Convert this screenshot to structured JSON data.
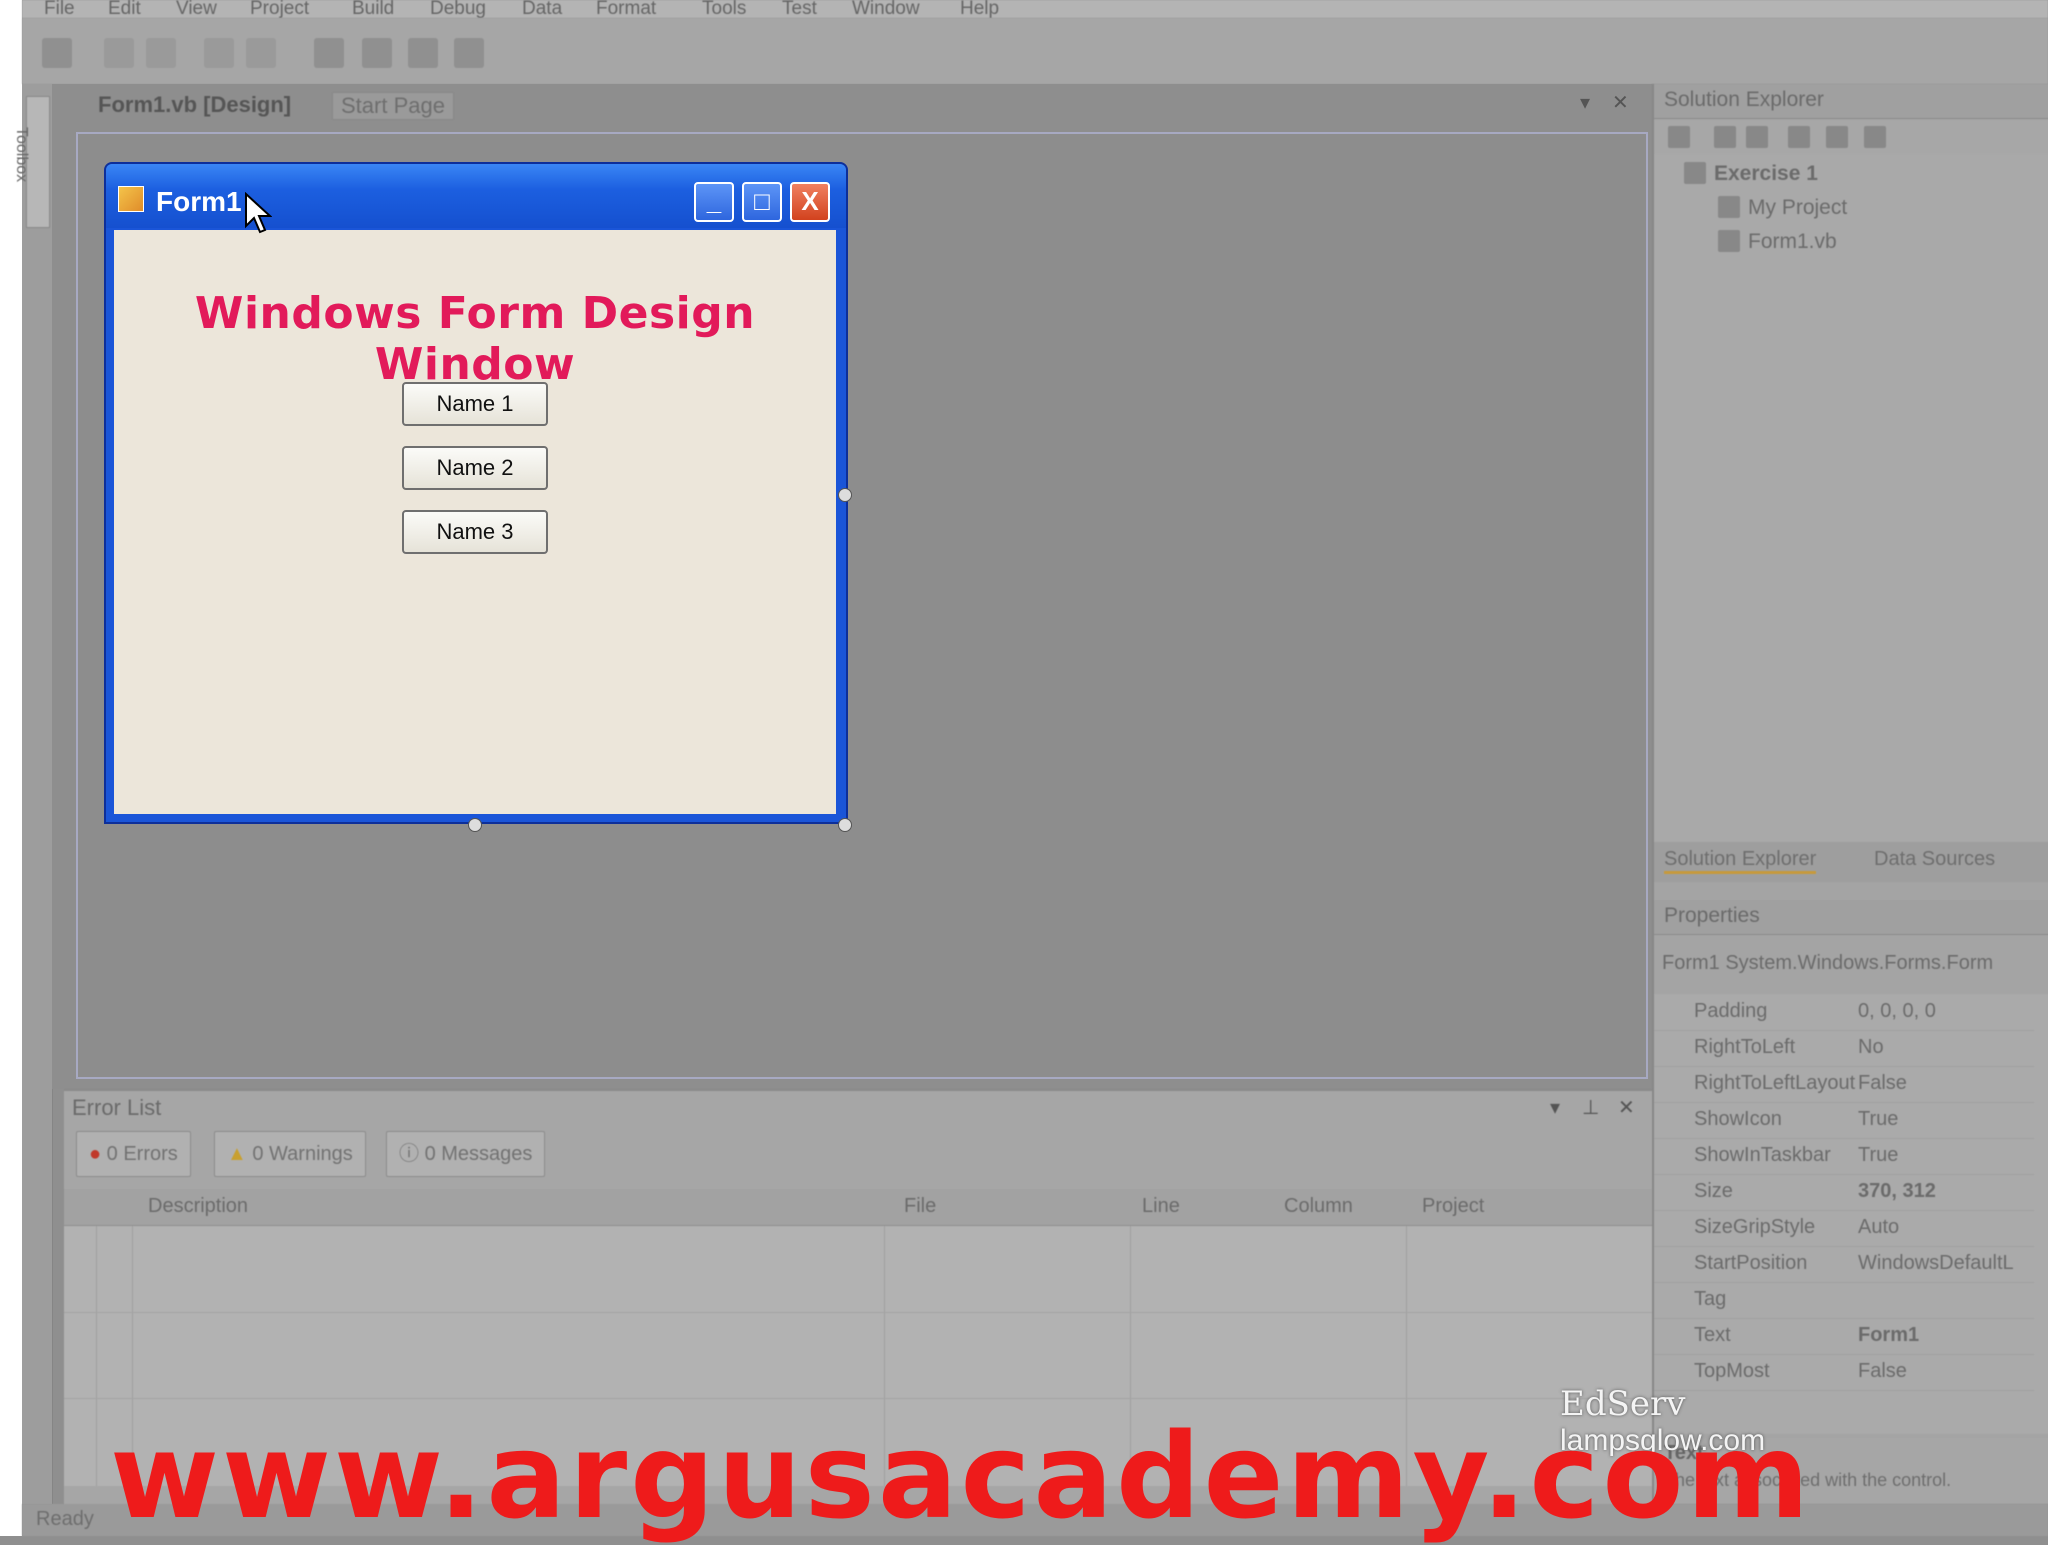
{
  "menu": [
    "File",
    "Edit",
    "View",
    "Project",
    "Build",
    "Debug",
    "Data",
    "Format",
    "Tools",
    "Test",
    "Window",
    "Help"
  ],
  "doc_tabs": {
    "design": "Form1.vb [Design]",
    "start": "Start Page"
  },
  "toolbox_label": "Toolbox",
  "form": {
    "title": "Form1",
    "heading": "Windows Form Design Window",
    "buttons": [
      "Name 1",
      "Name 2",
      "Name 3"
    ],
    "window_buttons": {
      "minimize": "_",
      "maximize": "□",
      "close": "X"
    }
  },
  "solution_explorer": {
    "title": "Solution Explorer",
    "tree": [
      "Exercise 1",
      "My Project",
      "Form1.vb"
    ],
    "tabs": [
      "Solution Explorer",
      "Data Sources"
    ]
  },
  "properties": {
    "title": "Properties",
    "object": "Form1 System.Windows.Forms.Form",
    "rows": [
      {
        "name": "Padding",
        "value": "0, 0, 0, 0"
      },
      {
        "name": "RightToLeft",
        "value": "No"
      },
      {
        "name": "RightToLeftLayout",
        "value": "False"
      },
      {
        "name": "ShowIcon",
        "value": "True"
      },
      {
        "name": "ShowInTaskbar",
        "value": "True"
      },
      {
        "name": "Size",
        "value": "370, 312"
      },
      {
        "name": "SizeGripStyle",
        "value": "Auto"
      },
      {
        "name": "StartPosition",
        "value": "WindowsDefaultL"
      },
      {
        "name": "Tag",
        "value": ""
      },
      {
        "name": "Text",
        "value": "Form1"
      },
      {
        "name": "TopMost",
        "value": "False"
      }
    ],
    "desc_title": "Text",
    "desc_text": "The text associated with the control."
  },
  "error_list": {
    "title": "Error List",
    "filters": [
      "0 Errors",
      "0 Warnings",
      "0 Messages"
    ],
    "columns": [
      "Description",
      "File",
      "Line",
      "Column",
      "Project"
    ]
  },
  "status": "Ready",
  "watermark": "www.argusacademy.com",
  "edserv": {
    "line1": "EdServ",
    "line2": "lampsglow.com"
  }
}
